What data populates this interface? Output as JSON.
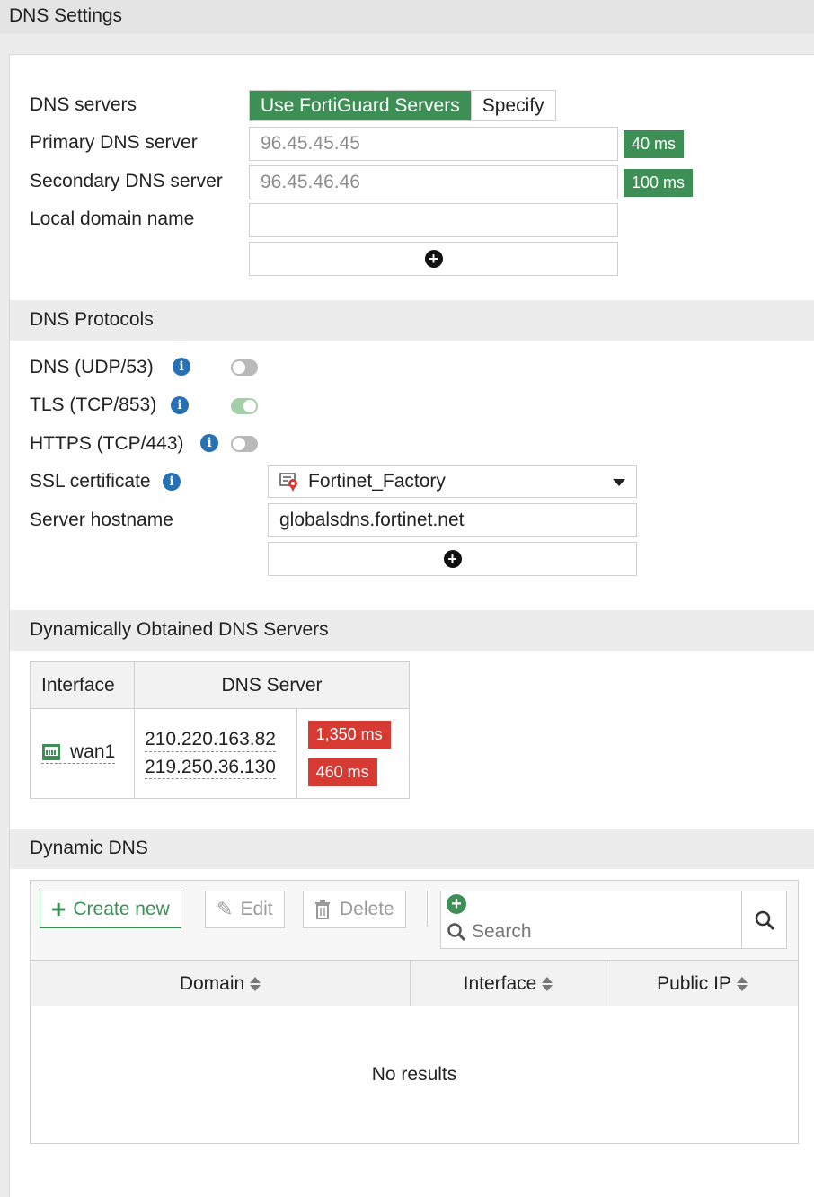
{
  "title": "DNS Settings",
  "dns_servers": {
    "label": "DNS servers",
    "options": [
      "Use FortiGuard Servers",
      "Specify"
    ],
    "selected": "Use FortiGuard Servers"
  },
  "primary": {
    "label": "Primary DNS server",
    "value": "96.45.45.45",
    "latency": "40 ms"
  },
  "secondary": {
    "label": "Secondary DNS server",
    "value": "96.45.46.46",
    "latency": "100 ms"
  },
  "local_domain": {
    "label": "Local domain name",
    "value": ""
  },
  "protocols": {
    "heading": "DNS Protocols",
    "items": [
      {
        "label": "DNS (UDP/53)",
        "enabled": false
      },
      {
        "label": "TLS (TCP/853)",
        "enabled": true
      },
      {
        "label": "HTTPS (TCP/443)",
        "enabled": false
      }
    ],
    "ssl_label": "SSL certificate",
    "ssl_value": "Fortinet_Factory",
    "hostname_label": "Server hostname",
    "hostname_value": "globalsdns.fortinet.net"
  },
  "dynamic_servers": {
    "heading": "Dynamically Obtained DNS Servers",
    "columns": [
      "Interface",
      "DNS Server"
    ],
    "interface": "wan1",
    "servers": [
      {
        "ip": "210.220.163.82",
        "latency": "1,350 ms"
      },
      {
        "ip": "219.250.36.130",
        "latency": "460 ms"
      }
    ]
  },
  "dynamic_dns": {
    "heading": "Dynamic DNS",
    "create_label": "Create new",
    "edit_label": "Edit",
    "delete_label": "Delete",
    "search_placeholder": "Search",
    "columns": [
      "Domain",
      "Interface",
      "Public IP"
    ],
    "empty_text": "No results"
  },
  "colors": {
    "accent_green": "#3d8f55",
    "latency_red": "#d63a32",
    "info_blue": "#2670b4"
  }
}
